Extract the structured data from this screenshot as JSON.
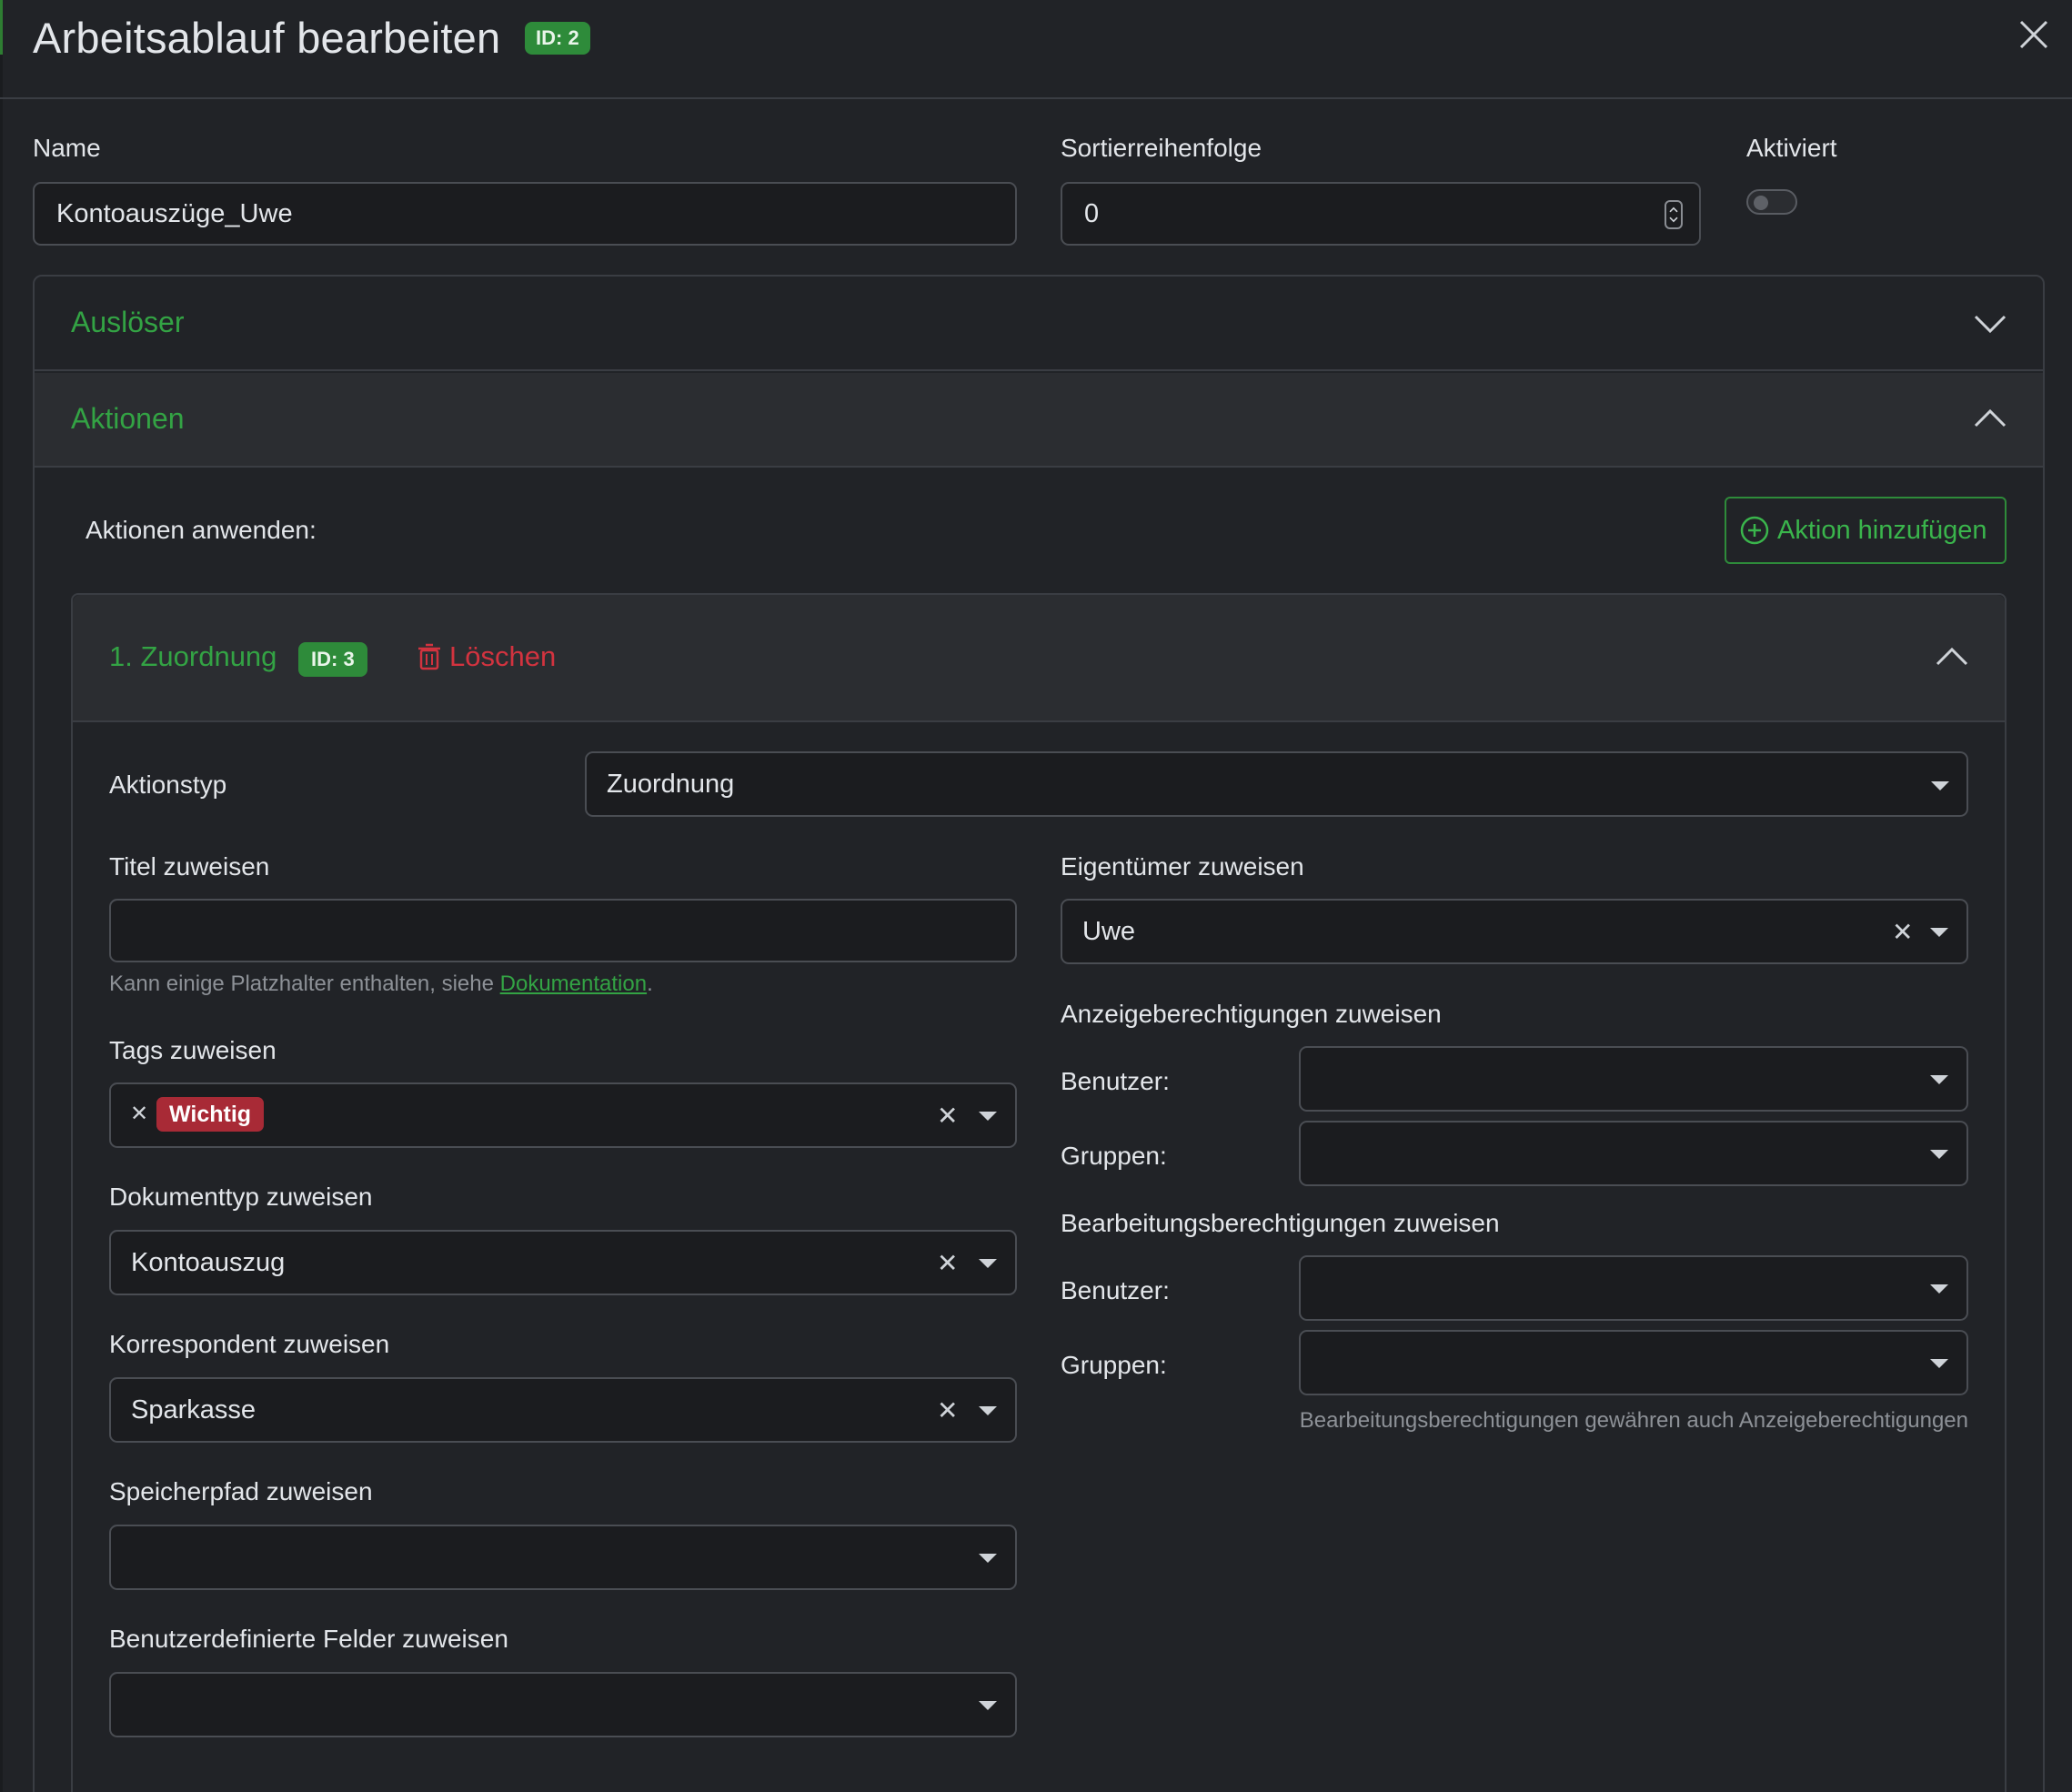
{
  "dialog": {
    "title": "Arbeitsablauf bearbeiten",
    "id_badge": "ID: 2"
  },
  "form": {
    "name_label": "Name",
    "name_value": "Kontoauszüge_Uwe",
    "sort_label": "Sortierreihenfolge",
    "sort_value": "0",
    "enabled_label": "Aktiviert",
    "enabled": false
  },
  "sections": {
    "triggers": "Auslöser",
    "actions": "Aktionen"
  },
  "actions": {
    "apply_label": "Aktionen anwenden:",
    "add_button": "Aktion hinzufügen",
    "item": {
      "title": "1. Zuordnung",
      "id_badge": "ID: 3",
      "delete_label": "Löschen",
      "type_label": "Aktionstyp",
      "type_value": "Zuordnung",
      "title_assign_label": "Titel zuweisen",
      "title_assign_value": "",
      "help_prefix": "Kann einige Platzhalter enthalten, siehe ",
      "help_link": "Dokumentation",
      "help_suffix": ".",
      "tags_label": "Tags zuweisen",
      "tags": [
        "Wichtig"
      ],
      "doctype_label": "Dokumenttyp zuweisen",
      "doctype_value": "Kontoauszug",
      "correspondent_label": "Korrespondent zuweisen",
      "correspondent_value": "Sparkasse",
      "storage_label": "Speicherpfad zuweisen",
      "storage_value": "",
      "custom_fields_label": "Benutzerdefinierte Felder zuweisen",
      "custom_fields_value": "",
      "owner_label": "Eigentümer zuweisen",
      "owner_value": "Uwe",
      "view_perm_label": "Anzeigeberechtigungen zuweisen",
      "edit_perm_label": "Bearbeitungsberechtigungen zuweisen",
      "users_label": "Benutzer:",
      "groups_label": "Gruppen:",
      "perm_note": "Bearbeitungsberechtigungen gewähren auch Anzeigeberechtigungen"
    }
  },
  "colors": {
    "accent_green": "#33a344",
    "danger_red": "#d2333f",
    "tag_red": "#a82a36",
    "background": "#212327"
  },
  "icons": [
    "close-icon",
    "chevron-down-icon",
    "chevron-up-icon",
    "plus-circle-icon",
    "trash-icon",
    "clear-x-icon",
    "caret-down-icon",
    "spinner-icon"
  ]
}
